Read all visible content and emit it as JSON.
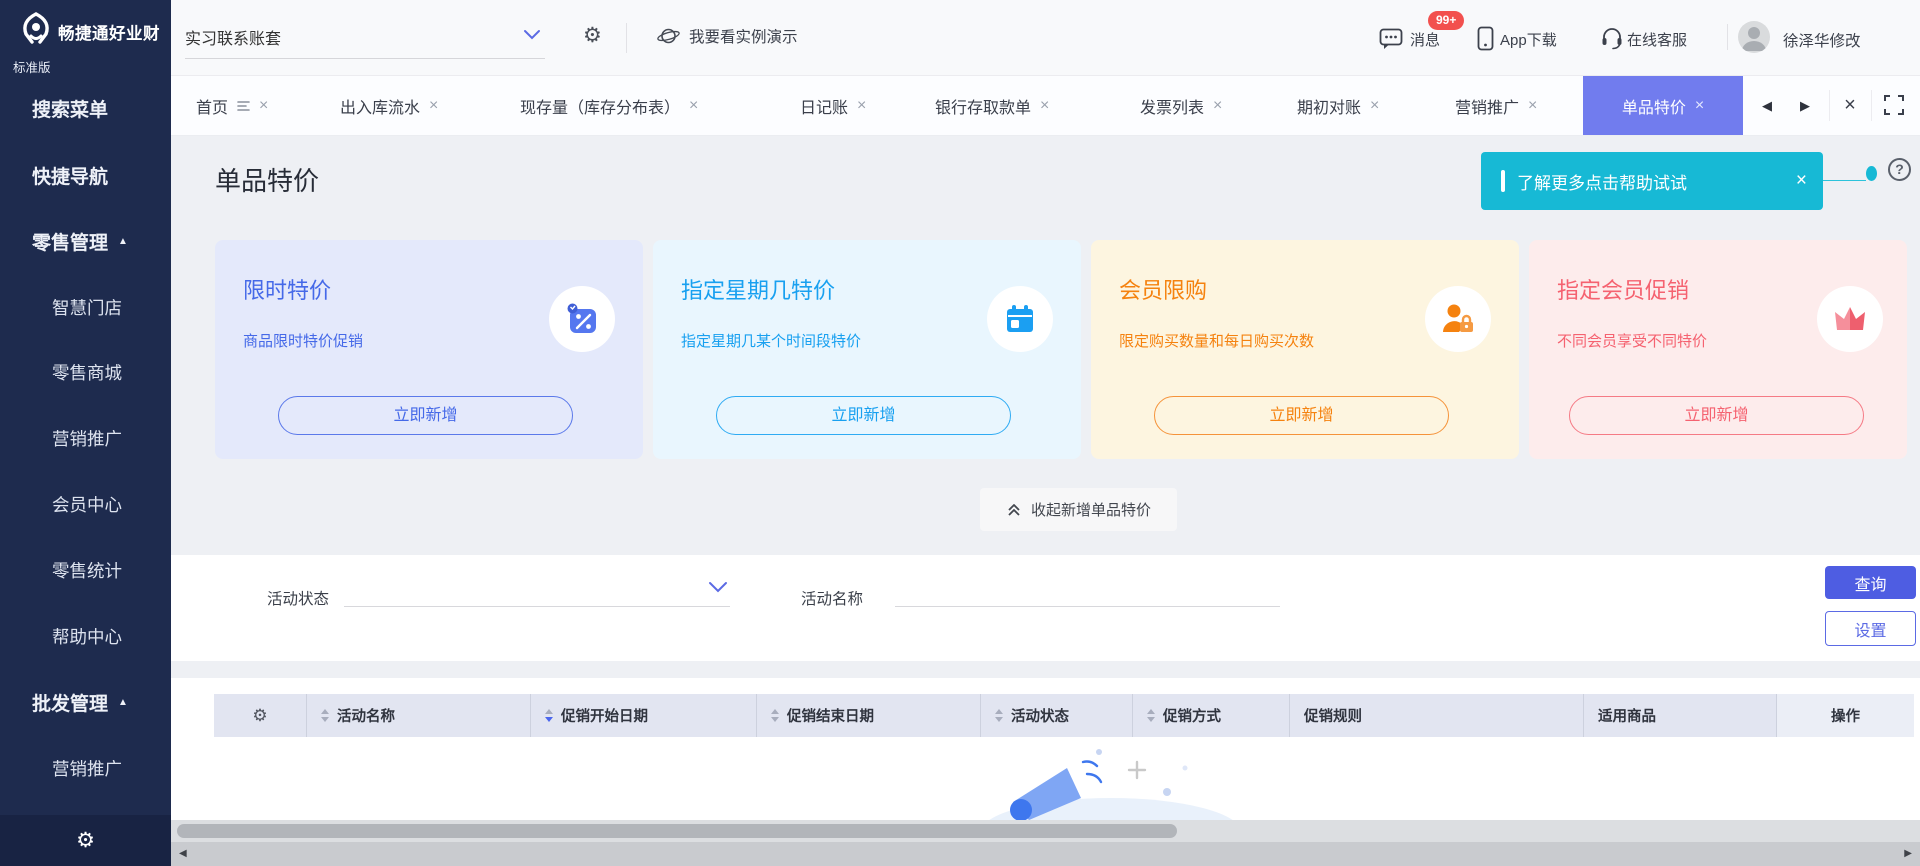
{
  "brand": {
    "name": "畅捷通好业财",
    "edition": "标准版"
  },
  "header": {
    "account_set": "实习联系账套",
    "demo_link": "我要看实例演示",
    "messages_label": "消息",
    "messages_badge": "99+",
    "app_download_label": "App下载",
    "online_service_label": "在线客服",
    "user_name": "徐泽华修改"
  },
  "sidebar": {
    "items": [
      {
        "label": "搜索菜单"
      },
      {
        "label": "快捷导航"
      },
      {
        "label": "零售管理"
      },
      {
        "label": "智慧门店"
      },
      {
        "label": "零售商城"
      },
      {
        "label": "营销推广"
      },
      {
        "label": "会员中心"
      },
      {
        "label": "零售统计"
      },
      {
        "label": "帮助中心"
      },
      {
        "label": "批发管理"
      },
      {
        "label": "营销推广"
      }
    ]
  },
  "tabs": {
    "items": [
      {
        "label": "首页"
      },
      {
        "label": "出入库流水"
      },
      {
        "label": "现存量（库存分布表）"
      },
      {
        "label": "日记账"
      },
      {
        "label": "银行存取款单"
      },
      {
        "label": "发票列表"
      },
      {
        "label": "期初对账"
      },
      {
        "label": "营销推广"
      },
      {
        "label": "单品特价"
      }
    ],
    "active": "单品特价"
  },
  "page": {
    "title": "单品特价",
    "help_banner_text": "了解更多点击帮助试试"
  },
  "cards": [
    {
      "title": "限时特价",
      "desc": "商品限时特价促销",
      "action": "立即新增",
      "accent": "#4569E8",
      "bg": "#E4E9FB",
      "icon": "discount-icon"
    },
    {
      "title": "指定星期几特价",
      "desc": "指定星期几某个时间段特价",
      "action": "立即新增",
      "accent": "#18A0F0",
      "bg": "#E9F6FE",
      "icon": "calendar-icon"
    },
    {
      "title": "会员限购",
      "desc": "限定购买数量和每日购买次数",
      "action": "立即新增",
      "accent": "#F5820F",
      "bg": "#FDF5E0",
      "icon": "member-lock-icon"
    },
    {
      "title": "指定会员促销",
      "desc": "不同会员享受不同特价",
      "action": "立即新增",
      "accent": "#F56270",
      "bg": "#FDECEC",
      "icon": "crown-icon"
    }
  ],
  "collapse_toggle": {
    "label": "收起新增单品特价"
  },
  "filters": {
    "status_label": "活动状态",
    "name_label": "活动名称",
    "query_button": "查询",
    "settings_button": "设置"
  },
  "table": {
    "columns": [
      {
        "label": "",
        "icon": "gear"
      },
      {
        "label": "活动名称",
        "sortable": true
      },
      {
        "label": "促销开始日期",
        "sortable": true,
        "sort": "desc"
      },
      {
        "label": "促销结束日期",
        "sortable": true
      },
      {
        "label": "活动状态",
        "sortable": true
      },
      {
        "label": "促销方式",
        "sortable": true
      },
      {
        "label": "促销规则",
        "sortable": false
      },
      {
        "label": "适用商品",
        "sortable": false
      },
      {
        "label": "操作",
        "sortable": false
      }
    ],
    "rows": []
  },
  "icons": {
    "close": "×",
    "prev": "◀",
    "next": "▶",
    "triangle_up": "▲",
    "gear": "⚙",
    "question": "?"
  },
  "colors": {
    "sidebar_bg": "#1E2B4E",
    "active_tab": "#717CEE",
    "banner_teal": "#17B9D5",
    "query_button_bg": "#4E5DE2",
    "badge_red": "#F2504E"
  }
}
